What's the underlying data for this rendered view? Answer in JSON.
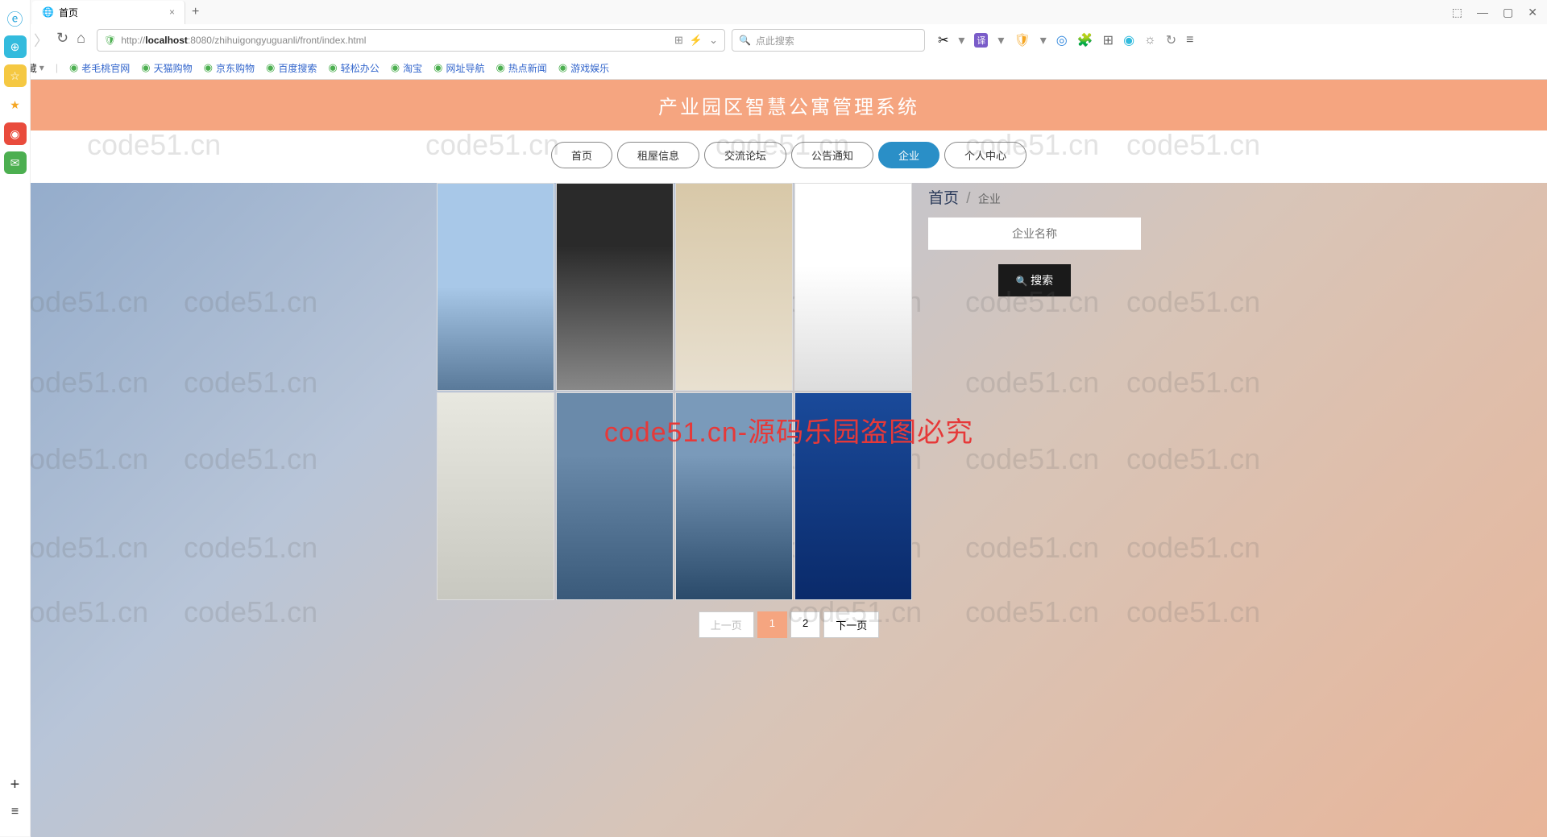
{
  "browser": {
    "tab_title": "首页",
    "url_prefix": "http://",
    "url_host": "localhost",
    "url_path": ":8080/zhihuigongyuguanli/front/index.html",
    "search_placeholder": "点此搜索",
    "bookmarks_label": "收藏",
    "bookmarks": [
      "老毛桃官网",
      "天猫购物",
      "京东购物",
      "百度搜索",
      "轻松办公",
      "淘宝",
      "网址导航",
      "热点新闻",
      "游戏娱乐"
    ]
  },
  "page": {
    "header_title": "产业园区智慧公寓管理系统",
    "nav_tabs": [
      {
        "label": "首页",
        "active": false
      },
      {
        "label": "租屋信息",
        "active": false
      },
      {
        "label": "交流论坛",
        "active": false
      },
      {
        "label": "公告通知",
        "active": false
      },
      {
        "label": "企业",
        "active": true
      },
      {
        "label": "个人中心",
        "active": false
      }
    ],
    "breadcrumb_home": "首页",
    "breadcrumb_current": "企业",
    "search_label": "企业名称",
    "search_button": "搜索",
    "pagination": {
      "prev": "上一页",
      "pages": [
        "1",
        "2"
      ],
      "active": "1",
      "next": "下一页"
    },
    "watermark_text": "code51.cn",
    "overlay_notice": "code51.cn-源码乐园盗图必究"
  }
}
